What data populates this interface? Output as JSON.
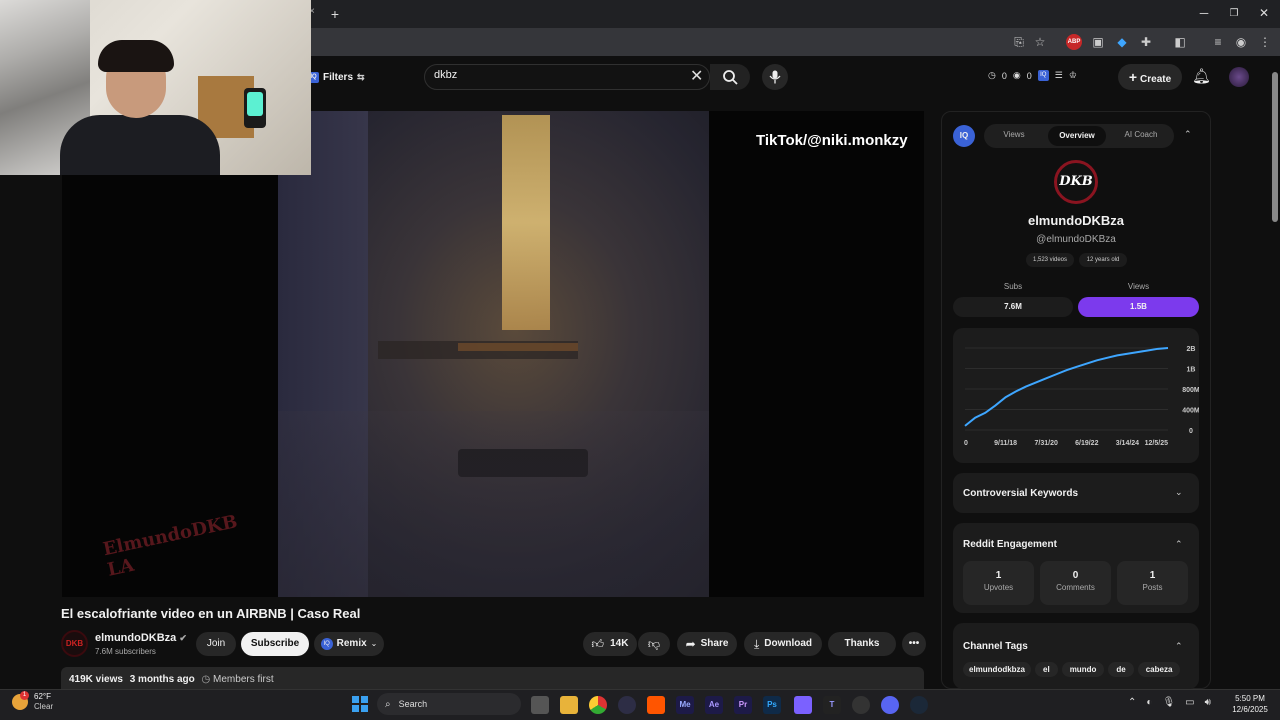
{
  "browser": {
    "new_tab_icon": "plus-icon",
    "window_controls": [
      "minimize",
      "maximize",
      "close"
    ]
  },
  "youtube_header": {
    "filters_label": "Filters",
    "search_value": "dkbz",
    "create_label": "Create",
    "counter_1": "0",
    "counter_2": "0"
  },
  "video": {
    "overlay_text": "TikTok/@niki.monkzy",
    "watermark_text": "ElmundoDKBLA",
    "title": "El escalofriante video en un AIRBNB | Caso Real"
  },
  "channel": {
    "name": "elmundoDKBza",
    "subscribers": "7.6M subscribers",
    "avatar_text": "DKB"
  },
  "actions": {
    "join": "Join",
    "subscribe": "Subscribe",
    "remix": "Remix",
    "likes": "14K",
    "share": "Share",
    "download": "Download",
    "thanks": "Thanks"
  },
  "description": {
    "views": "419K views",
    "age": "3 months ago",
    "members": "Members first"
  },
  "panel": {
    "tabs": [
      "Views",
      "Overview",
      "AI Coach"
    ],
    "active_tab": "Overview",
    "iq_badge": "IQ",
    "logo_text": "DKB",
    "channel_name": "elmundoDKBza",
    "handle": "@elmundoDKBza",
    "badge_videos": "1,523 videos",
    "badge_age": "12 years old",
    "subs_label": "Subs",
    "views_label": "Views",
    "subs_value": "7.6M",
    "views_value": "1.5B",
    "accent_color": "#7c3aed",
    "line_color": "#3ea6ff",
    "sections": {
      "keywords": "Controversial Keywords",
      "reddit": "Reddit Engagement",
      "tags": "Channel Tags"
    },
    "reddit": {
      "upvotes_value": "1",
      "upvotes_label": "Upvotes",
      "comments_value": "0",
      "comments_label": "Comments",
      "posts_value": "1",
      "posts_label": "Posts"
    },
    "tags": [
      "elmundodkbza",
      "el",
      "mundo",
      "de",
      "cabeza"
    ]
  },
  "chart_data": {
    "type": "line",
    "x_ticks": [
      "0",
      "9/11/18",
      "7/31/20",
      "6/19/22",
      "3/14/24",
      "12/5/25"
    ],
    "y_ticks": [
      "0",
      "400M",
      "800M",
      "1B",
      "2B"
    ],
    "series": [
      {
        "values": [
          [
            0,
            0.05
          ],
          [
            0.05,
            0.15
          ],
          [
            0.1,
            0.21
          ],
          [
            0.15,
            0.3
          ],
          [
            0.2,
            0.4
          ],
          [
            0.25,
            0.47
          ],
          [
            0.3,
            0.53
          ],
          [
            0.35,
            0.58
          ],
          [
            0.4,
            0.63
          ],
          [
            0.45,
            0.68
          ],
          [
            0.5,
            0.73
          ],
          [
            0.55,
            0.77
          ],
          [
            0.6,
            0.81
          ],
          [
            0.65,
            0.85
          ],
          [
            0.7,
            0.88
          ],
          [
            0.75,
            0.91
          ],
          [
            0.8,
            0.93
          ],
          [
            0.85,
            0.95
          ],
          [
            0.9,
            0.97
          ],
          [
            0.95,
            0.99
          ],
          [
            1.0,
            1.0
          ]
        ]
      }
    ]
  },
  "taskbar": {
    "weather_temp": "62°F",
    "weather_desc": "Clear",
    "search_label": "Search",
    "time": "5:50 PM",
    "date": "12/6/2025",
    "notification_count": "1"
  }
}
